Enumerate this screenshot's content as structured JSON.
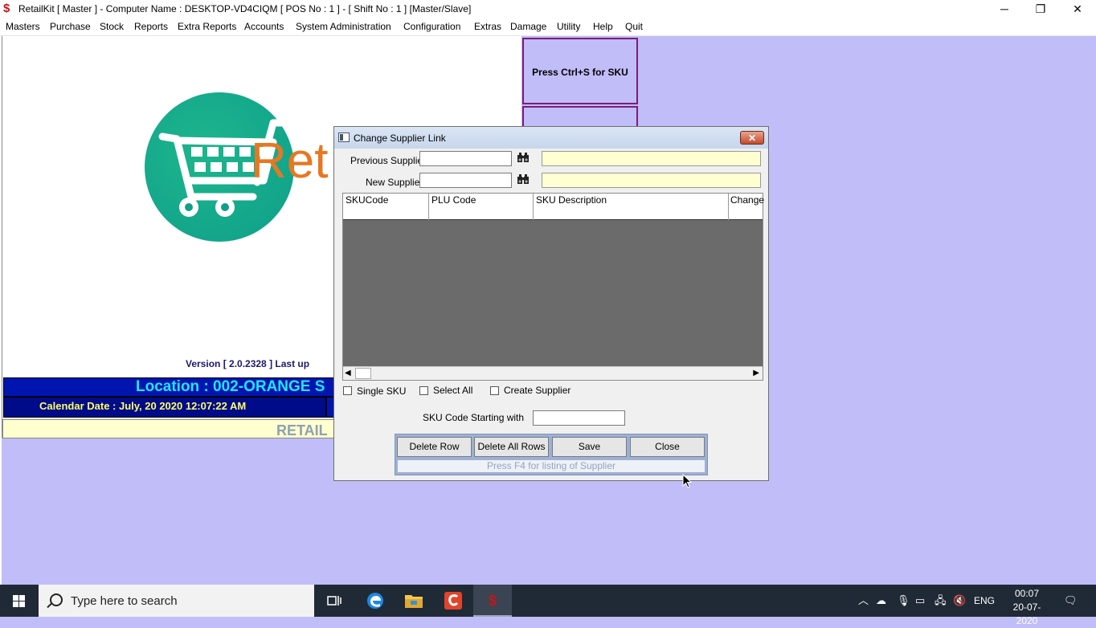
{
  "window": {
    "title": "RetailKit [ Master ] - Computer Name : DESKTOP-VD4CIQM [ POS No : 1 ] - [ Shift No : 1 ]  [Master/Slave]",
    "minimize": "─",
    "restore": "❐",
    "close": "✕"
  },
  "menu": [
    "Masters",
    "Purchase",
    "Stock",
    "Reports",
    "Extra Reports",
    "Accounts",
    "System Administration",
    "Configuration",
    "Extras",
    "Damage",
    "Utility",
    "Help",
    "Quit"
  ],
  "side_panel": {
    "sku_hint": "Press Ctrl+S for SKU"
  },
  "background": {
    "logo_text": "Ret",
    "version": "Version [ 2.0.2328 ]  Last up",
    "location": "Location : 002-ORANGE S",
    "calendar": "Calendar Date : July, 20 2020 12:07:22 AM",
    "retail": "RETAIL"
  },
  "dialog": {
    "title": "Change Supplier Link",
    "close": "✕",
    "previous_supplier_label": "Previous Supplier",
    "new_supplier_label": "New Supplier",
    "previous_supplier_value": "",
    "new_supplier_value": "",
    "columns": [
      "SKUCode",
      "PLU Code",
      "SKU Description",
      "Change"
    ],
    "single_sku": "Single SKU",
    "select_all": "Select All",
    "create_supplier": "Create Supplier",
    "sku_code_start_label": "SKU Code Starting with",
    "sku_code_start_value": "",
    "buttons": {
      "delete_row": "Delete Row",
      "delete_all_rows": "Delete All Rows",
      "save": "Save",
      "close": "Close"
    },
    "hint": "Press F4 for listing of Supplier"
  },
  "taskbar": {
    "search_placeholder": "Type here to search",
    "language": "ENG",
    "time": "00:07",
    "date": "20-07-2020"
  }
}
